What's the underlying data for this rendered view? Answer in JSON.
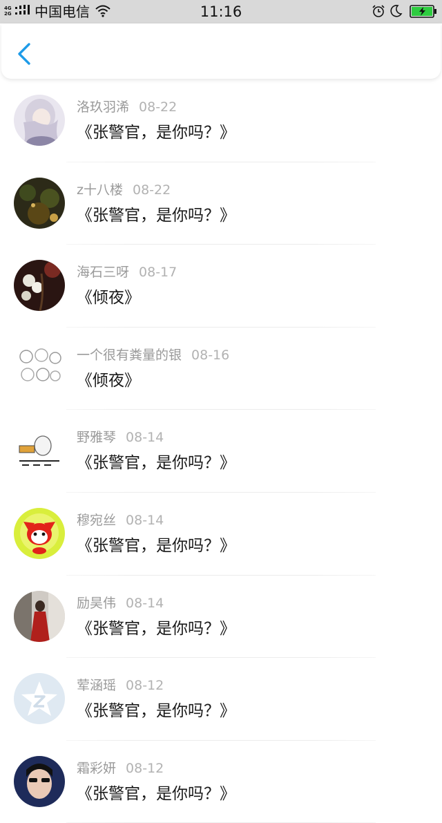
{
  "status_bar": {
    "network_top": "4G",
    "network_bottom": "2G",
    "carrier": "中国电信",
    "time": "11:16"
  },
  "header": {
    "back_icon": "chevron-left-icon",
    "accent_color": "#1e9be8"
  },
  "comments": [
    {
      "user": "洛玖羽浠",
      "date": "08-22",
      "book": "《张警官，是你吗？》"
    },
    {
      "user": "z十八楼",
      "date": "08-22",
      "book": "《张警官，是你吗？》"
    },
    {
      "user": "海石三呀",
      "date": "08-17",
      "book": "《倾夜》"
    },
    {
      "user": "一个很有粪量的银",
      "date": "08-16",
      "book": "《倾夜》"
    },
    {
      "user": "野雅琴",
      "date": "08-14",
      "book": "《张警官，是你吗？》"
    },
    {
      "user": "穆宛丝",
      "date": "08-14",
      "book": "《张警官，是你吗？》"
    },
    {
      "user": "励昊伟",
      "date": "08-14",
      "book": "《张警官，是你吗？》"
    },
    {
      "user": "荤涵瑶",
      "date": "08-12",
      "book": "《张警官，是你吗？》"
    },
    {
      "user": "霜彩妍",
      "date": "08-12",
      "book": "《张警官，是你吗？》"
    }
  ]
}
